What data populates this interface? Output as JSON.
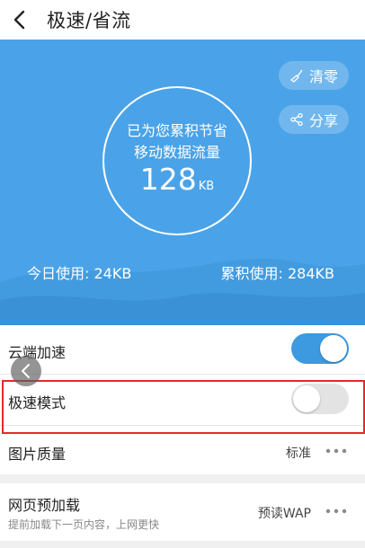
{
  "header": {
    "title": "极速/省流"
  },
  "hero": {
    "clear_label": "清零",
    "share_label": "分享",
    "line1": "已为您累积节省",
    "line2": "移动数据流量",
    "saved_value": "128",
    "saved_unit": "KB",
    "today_usage": "今日使用: 24KB",
    "total_usage": "累积使用: 284KB"
  },
  "settings": {
    "cloud_accel": {
      "label": "云端加速",
      "enabled": true
    },
    "fast_mode": {
      "label": "极速模式",
      "enabled": false
    },
    "image_quality": {
      "label": "图片质量",
      "value": "标准"
    },
    "preload": {
      "label": "网页预加载",
      "subtitle": "提前加载下一页内容，上网更快",
      "value": "预读WAP"
    }
  },
  "colors": {
    "hero_bg": "#4aa3e8",
    "toggle_on": "#3d99e0",
    "highlight": "#e02b2b"
  }
}
